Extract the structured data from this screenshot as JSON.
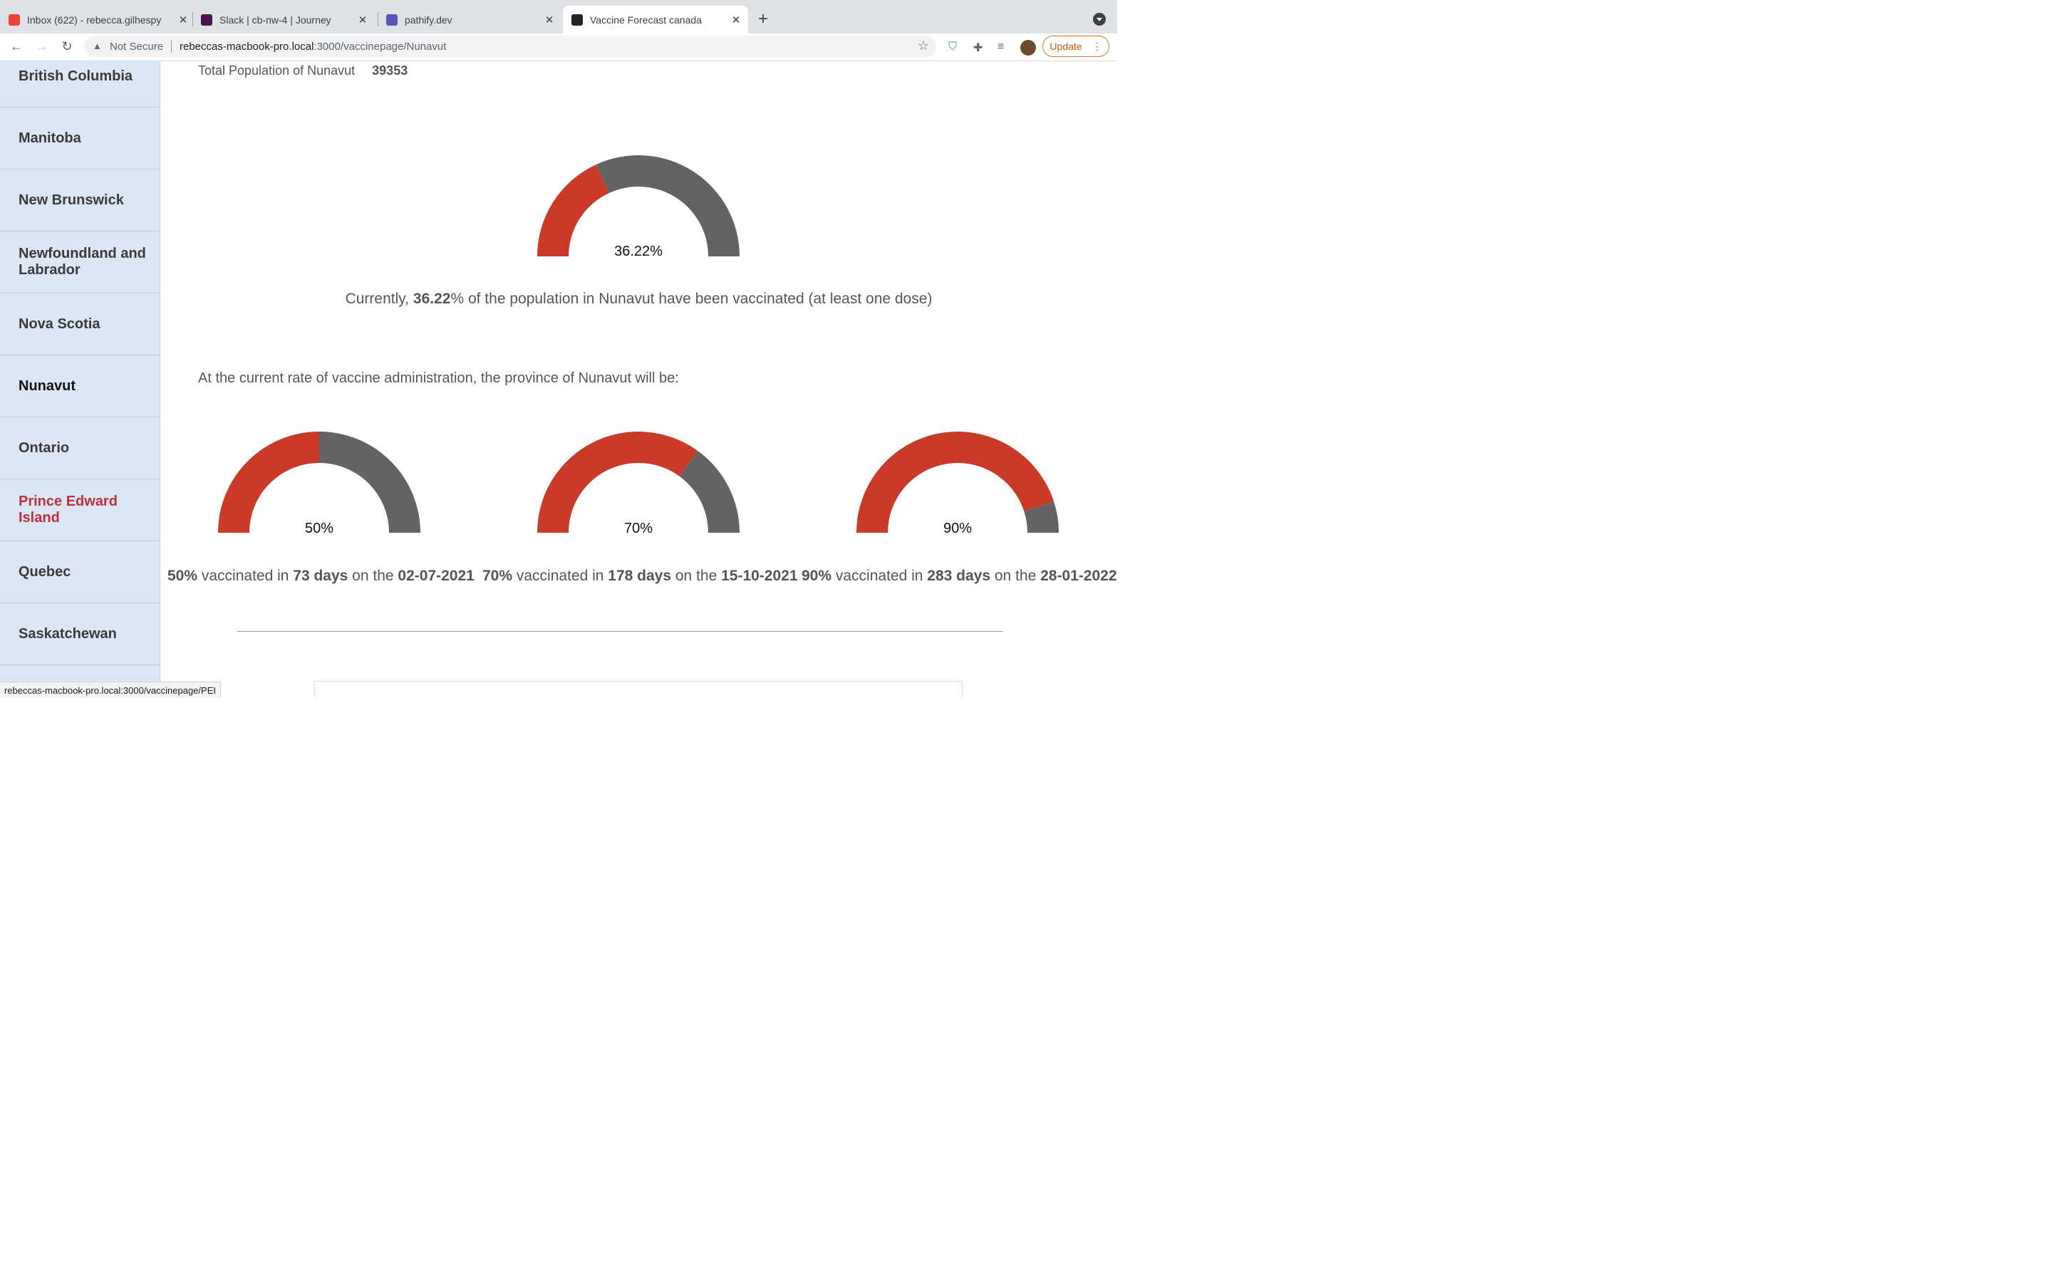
{
  "browser": {
    "tabs": [
      {
        "title": "Inbox (622) - rebecca.gilhespy",
        "favicon": "gmail-icon",
        "active": false
      },
      {
        "title": "Slack | cb-nw-4 | Journey",
        "favicon": "slack-icon",
        "active": false
      },
      {
        "title": "pathify.dev",
        "favicon": "pathify-icon",
        "active": false
      },
      {
        "title": "Vaccine Forecast canada",
        "favicon": "react-icon",
        "active": true
      }
    ],
    "new_tab": "+",
    "security_label": "Not Secure",
    "url_host": "rebeccas-macbook-pro.local",
    "url_rest": ":3000/vaccinepage/Nunavut",
    "update_label": "Update",
    "status_url": "rebeccas-macbook-pro.local:3000/vaccinepage/PEI"
  },
  "sidebar": {
    "items": [
      {
        "label": "British Columbia"
      },
      {
        "label": "Manitoba"
      },
      {
        "label": "New Brunswick"
      },
      {
        "label": "Newfoundland and Labrador"
      },
      {
        "label": "Nova Scotia"
      },
      {
        "label": "Nunavut"
      },
      {
        "label": "Ontario"
      },
      {
        "label": "Prince Edward Island"
      },
      {
        "label": "Quebec"
      },
      {
        "label": "Saskatchewan"
      }
    ],
    "current": "Nunavut",
    "hovered": "Prince Edward Island"
  },
  "main": {
    "total_label": "Total Population of Nunavut",
    "total_value": "39353",
    "current_gauge": {
      "value": 36.22,
      "label": "36.22%"
    },
    "current_text": {
      "prefix": "Currently, ",
      "pct": "36.22",
      "suffix": "% of the population in Nunavut have been vaccinated (at least one dose)"
    },
    "rate_text": "At the current rate of vaccine administration, the province of Nunavut will be:",
    "forecasts": [
      {
        "value": 50,
        "label": "50%",
        "pct": "50%",
        "days": "73 days",
        "date": "02-07-2021"
      },
      {
        "value": 70,
        "label": "70%",
        "pct": "70%",
        "days": "178 days",
        "date": "15-10-2021"
      },
      {
        "value": 90,
        "label": "90%",
        "pct": "90%",
        "days": "283 days",
        "date": "28-01-2022"
      }
    ],
    "forecast_words": {
      "vaccinated_in": " vaccinated in ",
      "on_the": " on the "
    }
  },
  "colors": {
    "gauge_fill": "#c93a28",
    "gauge_rest": "#636363",
    "sidebar_bg": "#dce6f4",
    "hover_link": "#c0303a"
  }
}
